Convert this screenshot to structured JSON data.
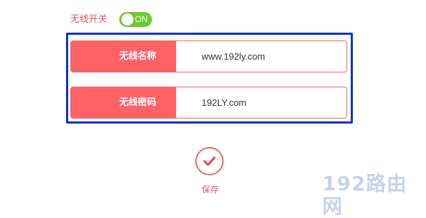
{
  "wireless_switch": {
    "label": "无线开关",
    "toggle_state": "ON",
    "toggle_color": "#6bc92d"
  },
  "form": {
    "ssid": {
      "label": "无线名称",
      "value": "www.192ly.com"
    },
    "password": {
      "label": "无线密码",
      "value": "192LY.com"
    }
  },
  "save": {
    "icon": "check-icon",
    "label": "保存"
  },
  "watermark": {
    "text": "192路由网"
  },
  "colors": {
    "accent": "#ff6266",
    "highlight_frame": "#0a32c8",
    "toggle_on": "#6bc92d"
  }
}
